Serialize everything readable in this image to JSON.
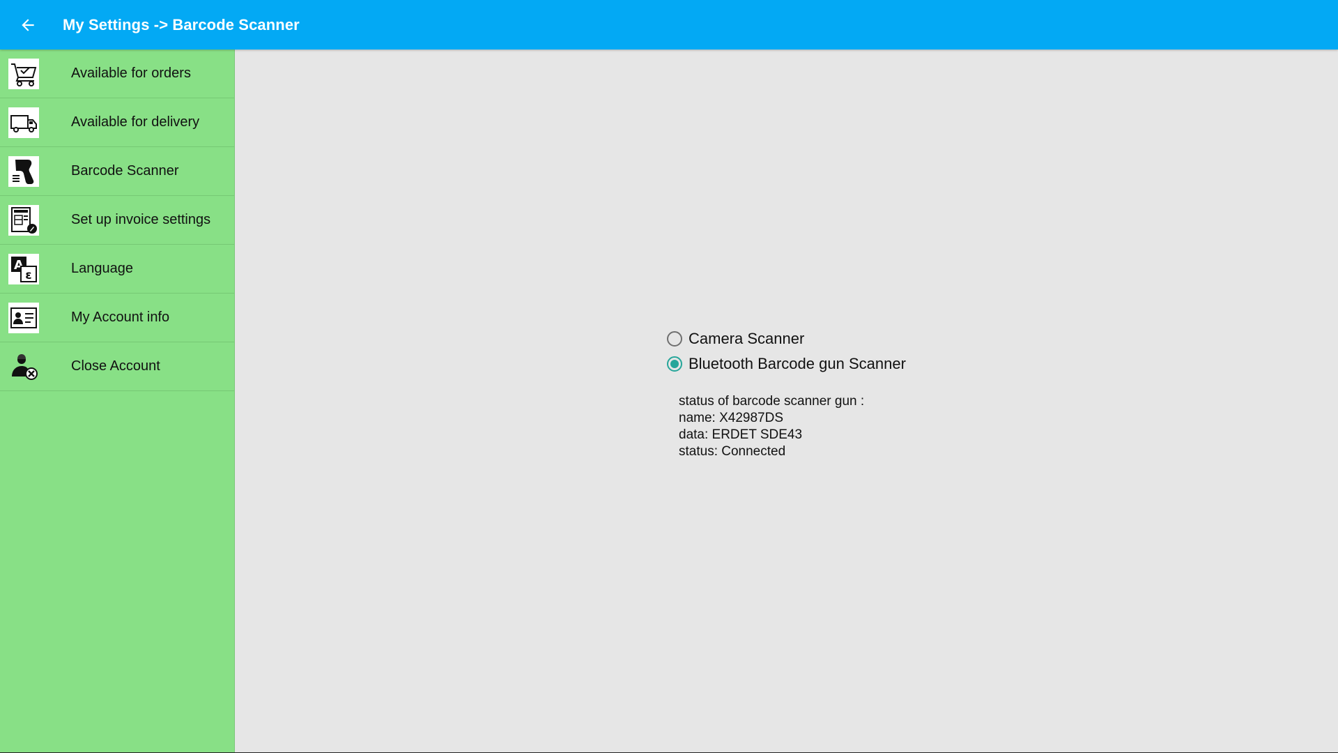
{
  "header": {
    "title": "My Settings -> Barcode Scanner",
    "back_icon": "arrow-left-icon",
    "background_color": "#03A9F4"
  },
  "sidebar": {
    "background_color": "#88E086",
    "items": [
      {
        "label": "Available for orders",
        "icon": "shopping-cart-check-icon"
      },
      {
        "label": "Available for delivery",
        "icon": "delivery-truck-icon"
      },
      {
        "label": "Barcode Scanner",
        "icon": "barcode-scanner-gun-icon"
      },
      {
        "label": "Set up invoice settings",
        "icon": "invoice-edit-icon"
      },
      {
        "label": "Language",
        "icon": "language-translate-icon"
      },
      {
        "label": "My Account info",
        "icon": "id-card-icon"
      },
      {
        "label": "Close Account",
        "icon": "user-remove-icon"
      }
    ]
  },
  "scanner_options": {
    "accent_color": "#26A69A",
    "options": [
      {
        "label": "Camera Scanner",
        "selected": false
      },
      {
        "label": "Bluetooth Barcode gun Scanner",
        "selected": true
      }
    ]
  },
  "status": {
    "heading": "status of barcode scanner gun :",
    "name_line": "name: X42987DS",
    "data_line": "data: ERDET SDE43",
    "status_line": "status: Connected"
  }
}
